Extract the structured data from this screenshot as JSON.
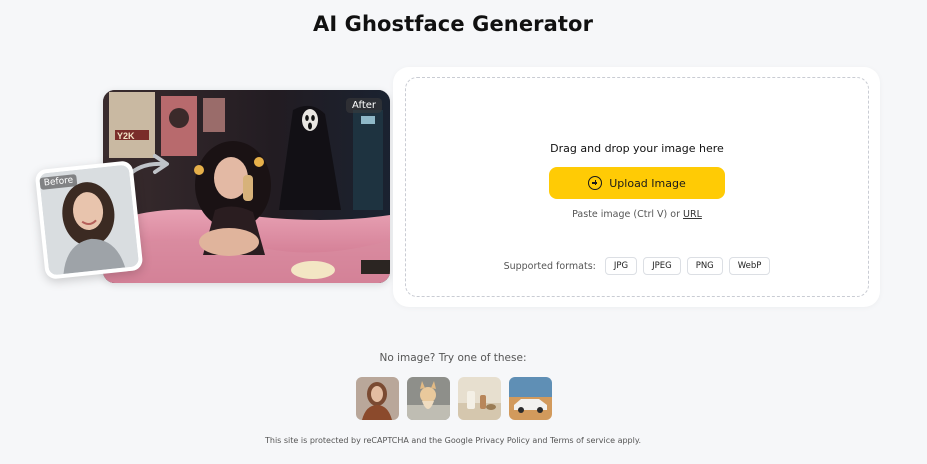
{
  "page": {
    "title": "AI Ghostface Generator"
  },
  "showcase": {
    "before_label": "Before",
    "after_label": "After",
    "poster_text": "Y2K"
  },
  "upload": {
    "drop_text": "Drag and drop your image here",
    "button_label": "Upload Image",
    "paste_text": "Paste image (Ctrl V) or",
    "url_link": "URL",
    "formats_label": "Supported formats:",
    "formats": [
      "JPG",
      "JPEG",
      "PNG",
      "WebP"
    ],
    "accent_color": "#ffcb05"
  },
  "samples": {
    "title": "No image? Try one of these:",
    "items": [
      "woman-portrait",
      "dog",
      "still-life",
      "white-car"
    ]
  },
  "footer": {
    "text": "This site is protected by reCAPTCHA and the Google Privacy Policy and Terms of service apply."
  }
}
